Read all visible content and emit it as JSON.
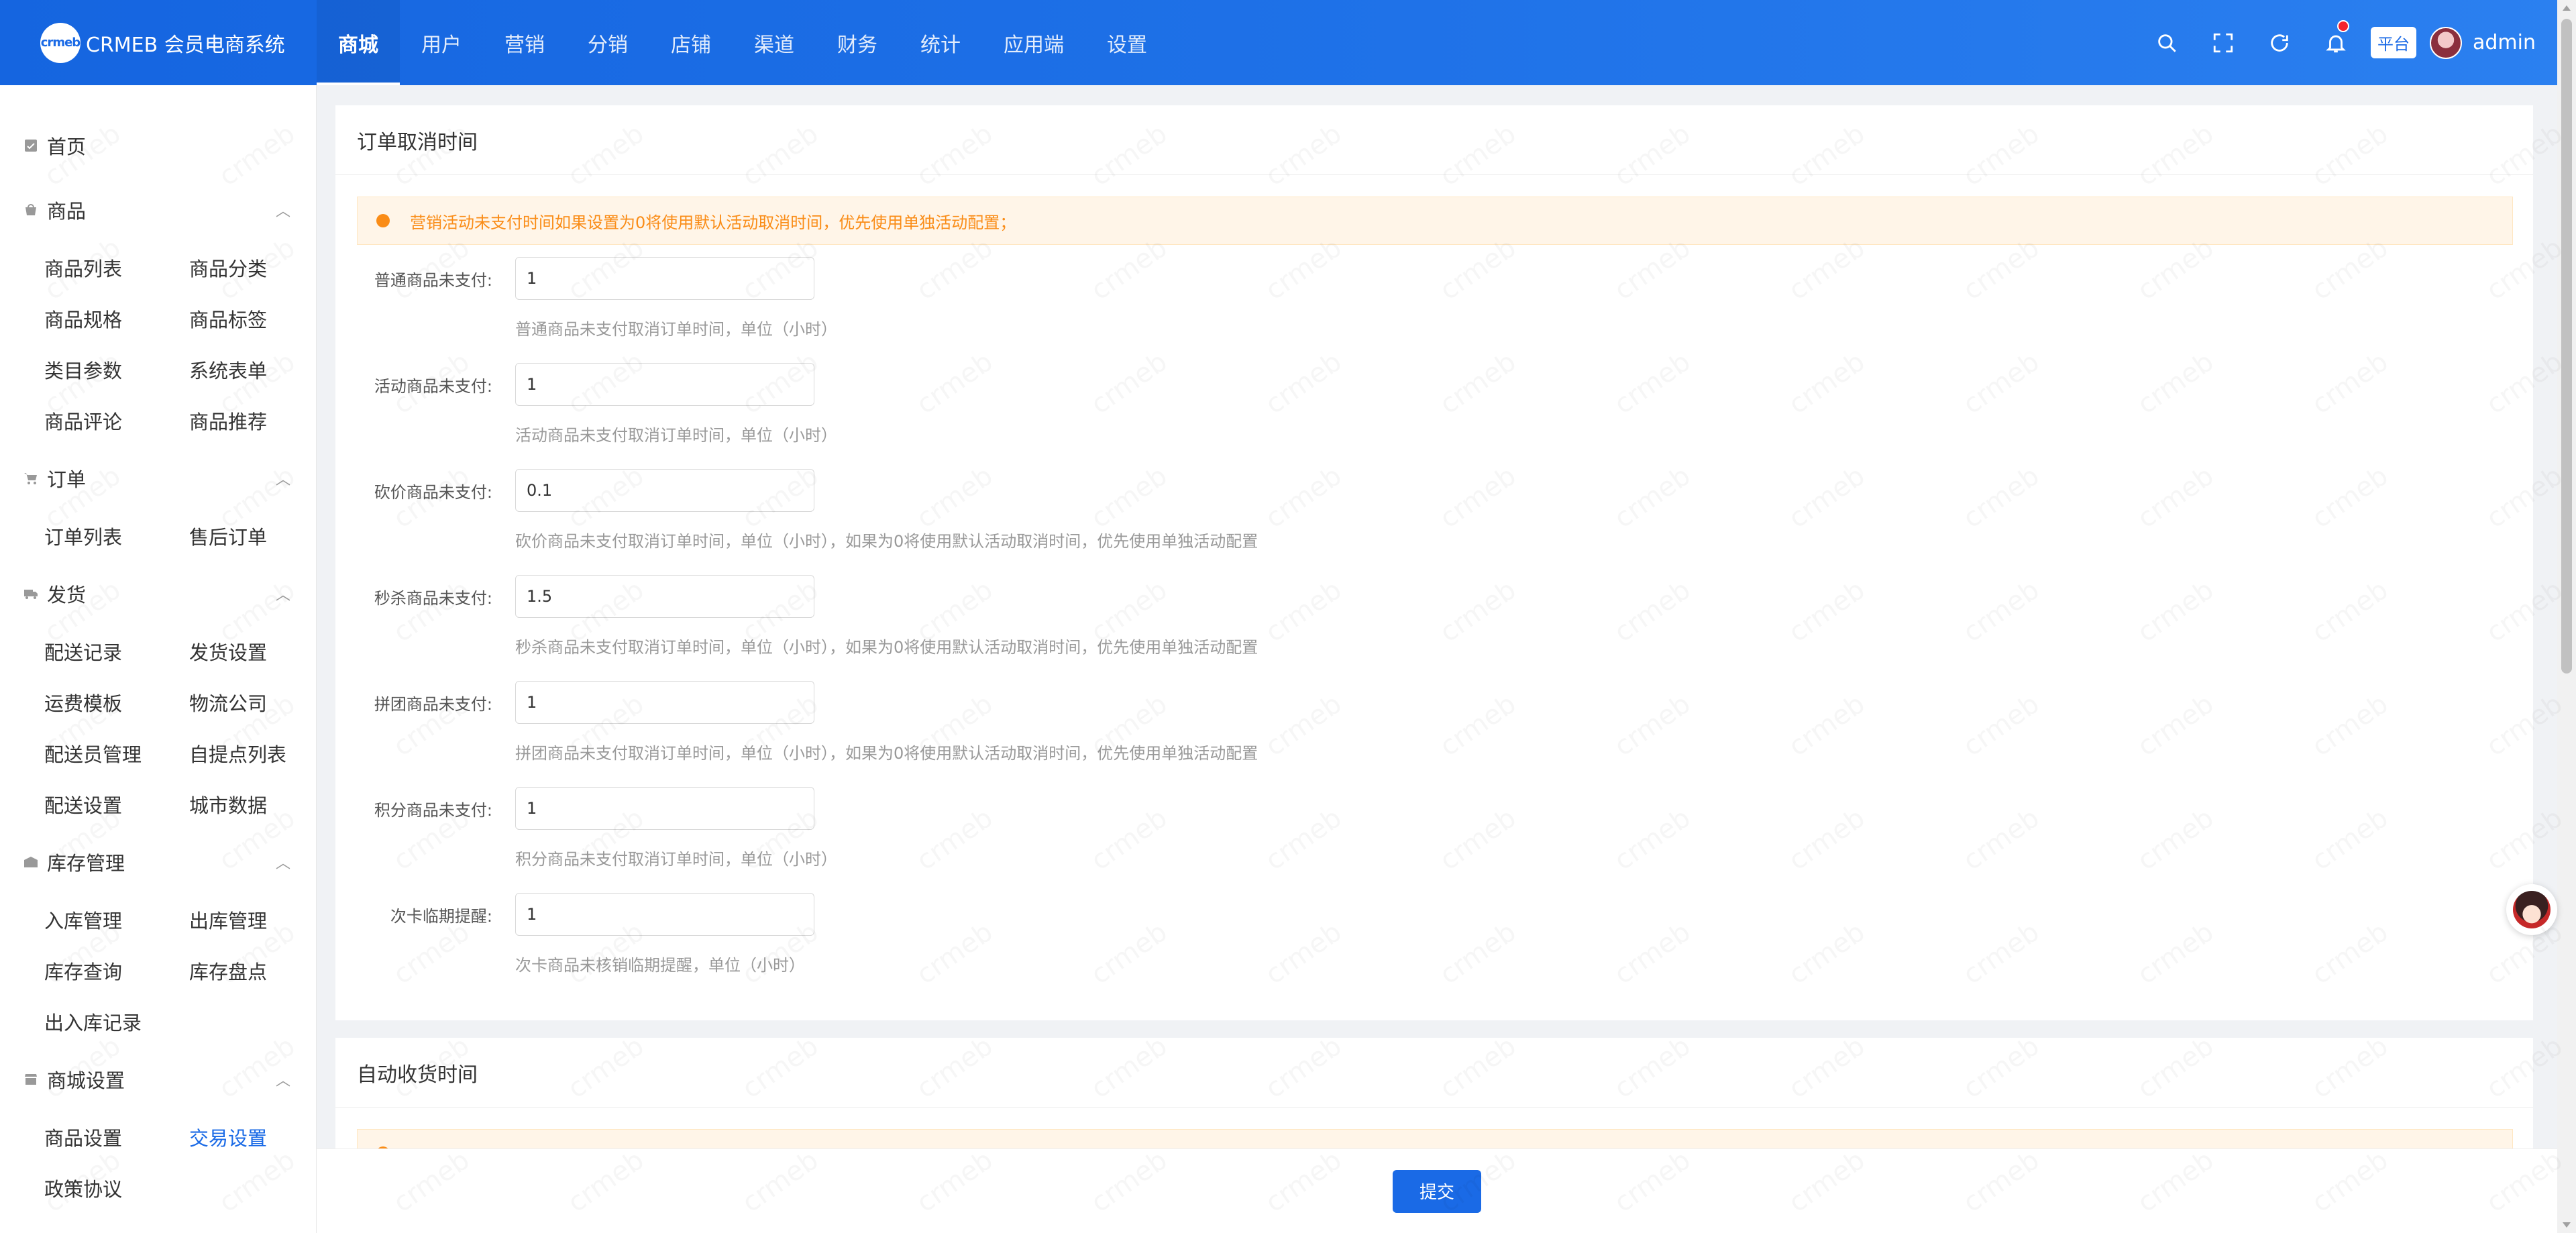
{
  "app": {
    "logo_mark": "crmeb",
    "title": "CRMEB 会员电商系统"
  },
  "topnav": [
    {
      "label": "商城",
      "active": true
    },
    {
      "label": "用户"
    },
    {
      "label": "营销"
    },
    {
      "label": "分销"
    },
    {
      "label": "店铺"
    },
    {
      "label": "渠道"
    },
    {
      "label": "财务"
    },
    {
      "label": "统计"
    },
    {
      "label": "应用端"
    },
    {
      "label": "设置"
    }
  ],
  "header": {
    "icons": [
      "search-icon",
      "fullscreen-icon",
      "refresh-icon",
      "bell-icon"
    ],
    "platform_tag": "平台",
    "username": "admin"
  },
  "sidebar": {
    "home": "首页",
    "groups": [
      {
        "label": "商品",
        "icon": "goods-icon",
        "items": [
          "商品列表",
          "商品分类",
          "商品规格",
          "商品标签",
          "类目参数",
          "系统表单",
          "商品评论",
          "商品推荐"
        ]
      },
      {
        "label": "订单",
        "icon": "cart-icon",
        "items": [
          "订单列表",
          "售后订单"
        ]
      },
      {
        "label": "发货",
        "icon": "truck-icon",
        "items": [
          "配送记录",
          "发货设置",
          "运费模板",
          "物流公司",
          "配送员管理",
          "自提点列表",
          "配送设置",
          "城市数据"
        ]
      },
      {
        "label": "库存管理",
        "icon": "warehouse-icon",
        "items": [
          "入库管理",
          "出库管理",
          "库存查询",
          "库存盘点",
          "出入库记录"
        ]
      },
      {
        "label": "商城设置",
        "icon": "store-icon",
        "items": [
          "商品设置",
          "交易设置",
          "政策协议"
        ],
        "active_item": "交易设置"
      }
    ]
  },
  "cancel_section": {
    "title": "订单取消时间",
    "alert": "营销活动未支付时间如果设置为0将使用默认活动取消时间，优先使用单独活动配置；",
    "fields": [
      {
        "label": "普通商品未支付:",
        "value": "1",
        "hint": "普通商品未支付取消订单时间，单位（小时）"
      },
      {
        "label": "活动商品未支付:",
        "value": "1",
        "hint": "活动商品未支付取消订单时间，单位（小时）"
      },
      {
        "label": "砍价商品未支付:",
        "value": "0.1",
        "hint": "砍价商品未支付取消订单时间，单位（小时），如果为0将使用默认活动取消时间，优先使用单独活动配置"
      },
      {
        "label": "秒杀商品未支付:",
        "value": "1.5",
        "hint": "秒杀商品未支付取消订单时间，单位（小时），如果为0将使用默认活动取消时间，优先使用单独活动配置"
      },
      {
        "label": "拼团商品未支付:",
        "value": "1",
        "hint": "拼团商品未支付取消订单时间，单位（小时），如果为0将使用默认活动取消时间，优先使用单独活动配置"
      },
      {
        "label": "积分商品未支付:",
        "value": "1",
        "hint": "积分商品未支付取消订单时间，单位（小时）"
      },
      {
        "label": "次卡临期提醒:",
        "value": "1",
        "hint": "次卡商品未核销临期提醒，单位（小时）"
      }
    ]
  },
  "receive_section": {
    "title": "自动收货时间"
  },
  "footer": {
    "submit_label": "提交"
  },
  "colors": {
    "primary": "#1a6ae6",
    "warning": "#fa8c16",
    "warning_bg": "#fff5e8"
  }
}
